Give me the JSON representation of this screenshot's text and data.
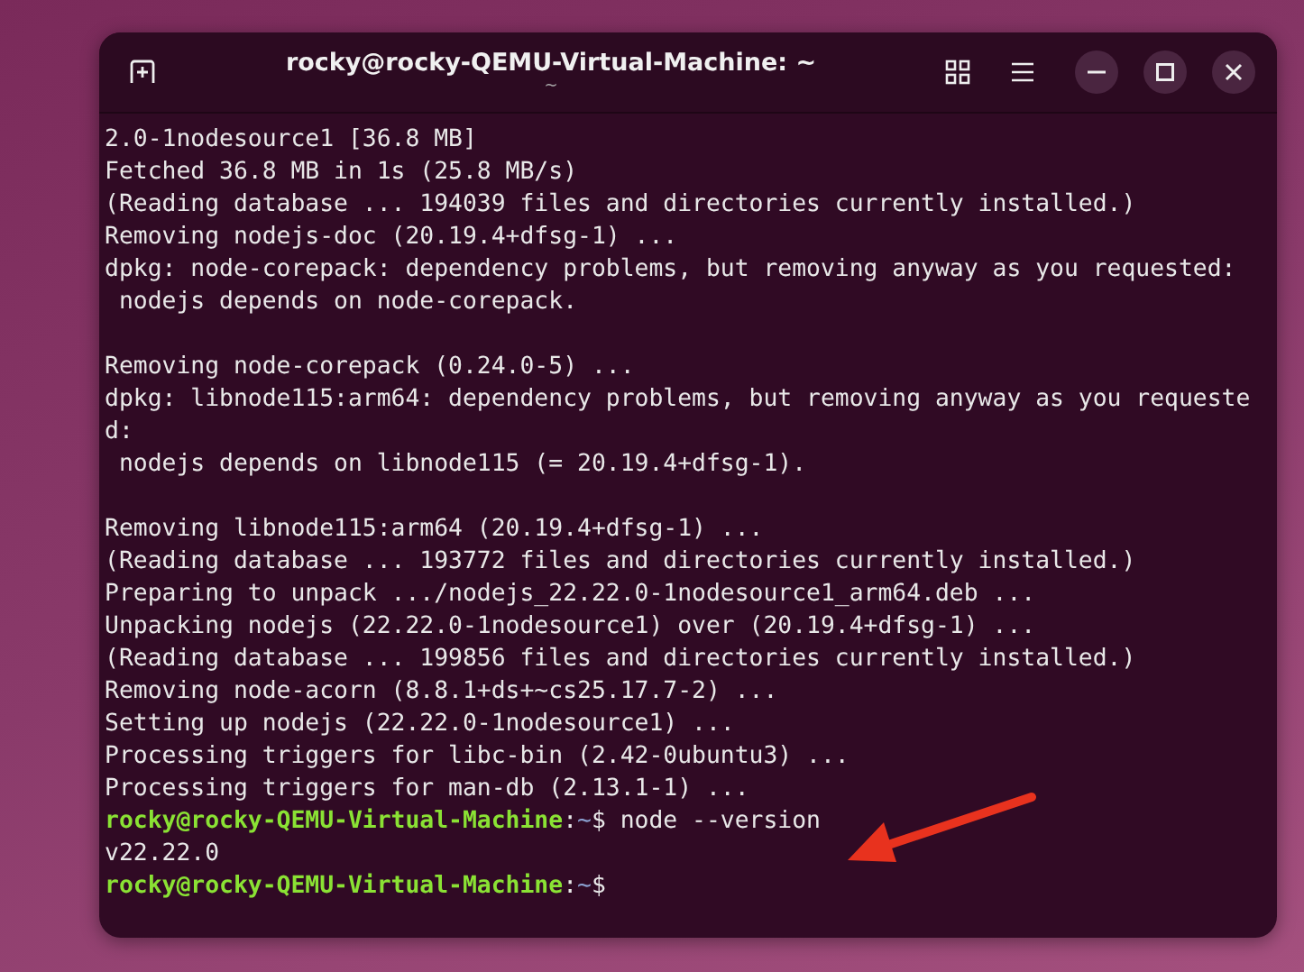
{
  "window": {
    "title": "rocky@rocky-QEMU-Virtual-Machine: ~",
    "subtitle": "~"
  },
  "terminal": {
    "lines": [
      {
        "kind": "output",
        "text": "2.0-1nodesource1 [36.8 MB]"
      },
      {
        "kind": "output",
        "text": "Fetched 36.8 MB in 1s (25.8 MB/s)"
      },
      {
        "kind": "output",
        "text": "(Reading database ... 194039 files and directories currently installed.)"
      },
      {
        "kind": "output",
        "text": "Removing nodejs-doc (20.19.4+dfsg-1) ..."
      },
      {
        "kind": "output",
        "text": "dpkg: node-corepack: dependency problems, but removing anyway as you requested:"
      },
      {
        "kind": "output",
        "text": " nodejs depends on node-corepack."
      },
      {
        "kind": "blank"
      },
      {
        "kind": "output",
        "text": "Removing node-corepack (0.24.0-5) ..."
      },
      {
        "kind": "output",
        "text": "dpkg: libnode115:arm64: dependency problems, but removing anyway as you requeste"
      },
      {
        "kind": "output",
        "text": "d:"
      },
      {
        "kind": "output",
        "text": " nodejs depends on libnode115 (= 20.19.4+dfsg-1)."
      },
      {
        "kind": "blank"
      },
      {
        "kind": "output",
        "text": "Removing libnode115:arm64 (20.19.4+dfsg-1) ..."
      },
      {
        "kind": "output",
        "text": "(Reading database ... 193772 files and directories currently installed.)"
      },
      {
        "kind": "output",
        "text": "Preparing to unpack .../nodejs_22.22.0-1nodesource1_arm64.deb ..."
      },
      {
        "kind": "output",
        "text": "Unpacking nodejs (22.22.0-1nodesource1) over (20.19.4+dfsg-1) ..."
      },
      {
        "kind": "output",
        "text": "(Reading database ... 199856 files and directories currently installed.)"
      },
      {
        "kind": "output",
        "text": "Removing node-acorn (8.8.1+ds+~cs25.17.7-2) ..."
      },
      {
        "kind": "output",
        "text": "Setting up nodejs (22.22.0-1nodesource1) ..."
      },
      {
        "kind": "output",
        "text": "Processing triggers for libc-bin (2.42-0ubuntu3) ..."
      },
      {
        "kind": "output",
        "text": "Processing triggers for man-db (2.13.1-1) ..."
      },
      {
        "kind": "prompt",
        "user_host": "rocky@rocky-QEMU-Virtual-Machine",
        "separator": ":",
        "path": "~",
        "symbol": "$",
        "command": "node --version"
      },
      {
        "kind": "output",
        "text": "v22.22.0"
      },
      {
        "kind": "prompt",
        "user_host": "rocky@rocky-QEMU-Virtual-Machine",
        "separator": ":",
        "path": "~",
        "symbol": "$"
      }
    ]
  }
}
